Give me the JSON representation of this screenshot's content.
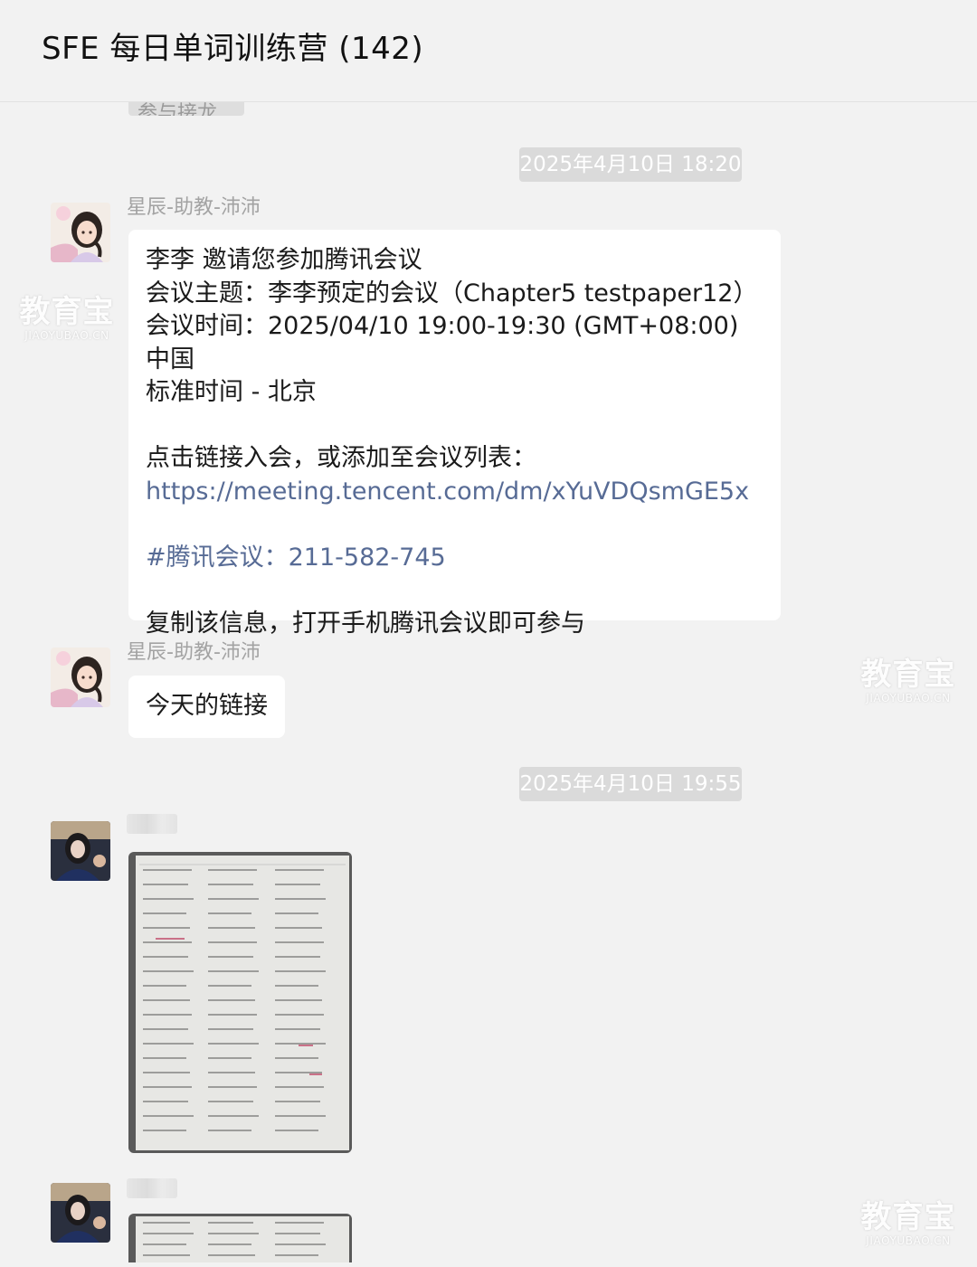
{
  "header": {
    "title": "SFE 每日单词训练营 (142)"
  },
  "prev_fragment": "参与接龙",
  "timestamps": [
    "2025年4月10日 18:20",
    "2025年4月10日 19:55"
  ],
  "messages": [
    {
      "sender": "星辰-助教-沛沛",
      "lines": [
        "李李 邀请您参加腾讯会议",
        "会议主题：李李预定的会议（Chapter5 testpaper12）",
        "会议时间：2025/04/10 19:00-19:30 (GMT+08:00) 中国",
        "标准时间 - 北京",
        "点击链接入会，或添加至会议列表：",
        "https://meeting.tencent.com/dm/xYuVDQsmGE5x",
        "#腾讯会议：211-582-745",
        "复制该信息，打开手机腾讯会议即可参与"
      ]
    },
    {
      "sender": "星辰-助教-沛沛",
      "text": "今天的链接"
    }
  ],
  "watermark": {
    "cn": "教育宝",
    "en": "JIAOYUBAO.CN"
  },
  "colors": {
    "background": "#f2f2f2",
    "bubble": "#ffffff",
    "link": "#576b95",
    "timestamp_bg": "#dadada"
  }
}
